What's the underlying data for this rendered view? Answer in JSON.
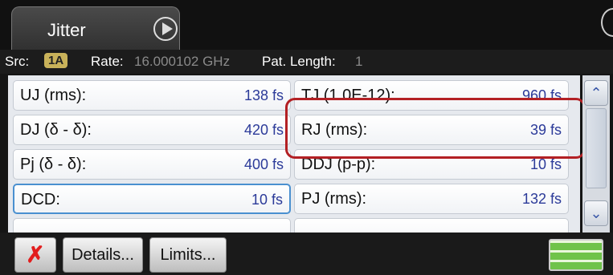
{
  "tab": {
    "title": "Jitter"
  },
  "status": {
    "src_label": "Src:",
    "src_value": "1A",
    "rate_label": "Rate:",
    "rate_value": "16.000102 GHz",
    "pat_label": "Pat. Length:",
    "pat_value": "1"
  },
  "measurements": {
    "left": [
      {
        "label": "UJ (rms):",
        "value": "138 fs"
      },
      {
        "label": "DJ (δ - δ):",
        "value": "420 fs"
      },
      {
        "label": "Pj (δ - δ):",
        "value": "400 fs"
      },
      {
        "label": "DCD:",
        "value": "10 fs"
      }
    ],
    "right": [
      {
        "label": "TJ (1.0E-12):",
        "value": "960 fs"
      },
      {
        "label": "RJ (rms):",
        "value": "39 fs"
      },
      {
        "label": "DDJ (p-p):",
        "value": "10 fs"
      },
      {
        "label": "PJ (rms):",
        "value": "132 fs"
      }
    ]
  },
  "highlight": {
    "color": "#b32024"
  },
  "toolbar": {
    "close_icon": "x-icon",
    "details_label": "Details...",
    "limits_label": "Limits..."
  },
  "icons": {
    "play": "play-icon",
    "scroll_up": "chevron-up-icon",
    "scroll_down": "chevron-down-icon",
    "status_indicator": "status-indicator-icon"
  },
  "colors": {
    "value_text": "#2b3a99",
    "selected_border": "#4a90d0",
    "indicator": "#6fc34a"
  }
}
